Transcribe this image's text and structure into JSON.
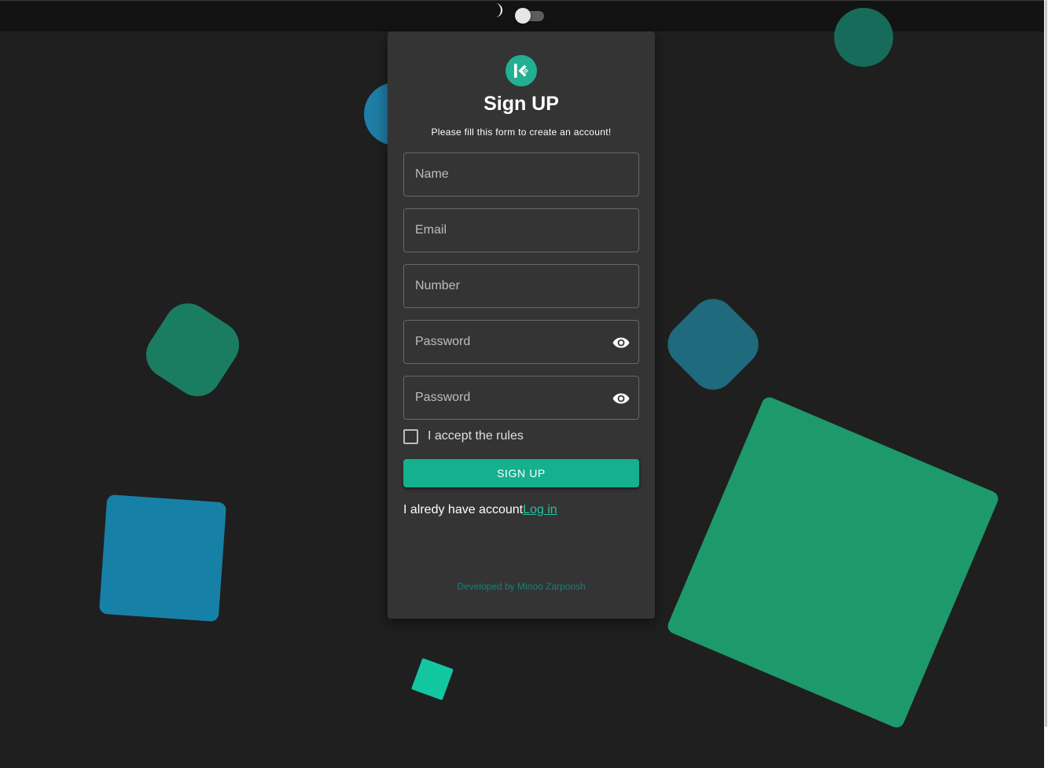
{
  "theme": {
    "background": "#1f1f1f",
    "card": "#343434",
    "accent": "#15b08e",
    "link": "#1ec5a1",
    "topbar": "#131313"
  },
  "topbar": {
    "theme_icon": "moon-icon",
    "dark_mode_toggle": "off"
  },
  "form": {
    "logo_icon": "kucoin-logo-icon",
    "title": "Sign UP",
    "subtitle": "Please fill this form to create an account!",
    "fields": {
      "name": {
        "placeholder": "Name",
        "value": ""
      },
      "email": {
        "placeholder": "Email",
        "value": ""
      },
      "number": {
        "placeholder": "Number",
        "value": ""
      },
      "password": {
        "placeholder": "Password",
        "value": "",
        "icon": "eye-icon"
      },
      "confirm_password": {
        "placeholder": "Password",
        "value": "",
        "icon": "eye-icon"
      }
    },
    "accept_rules_label": "I accept the rules",
    "accept_rules_checked": false,
    "submit_label": "SIGN UP",
    "have_account_text": "I alredy have account",
    "login_link": "Log in"
  },
  "footer": {
    "credit": "Developed by Minoo Zarpoosh"
  }
}
